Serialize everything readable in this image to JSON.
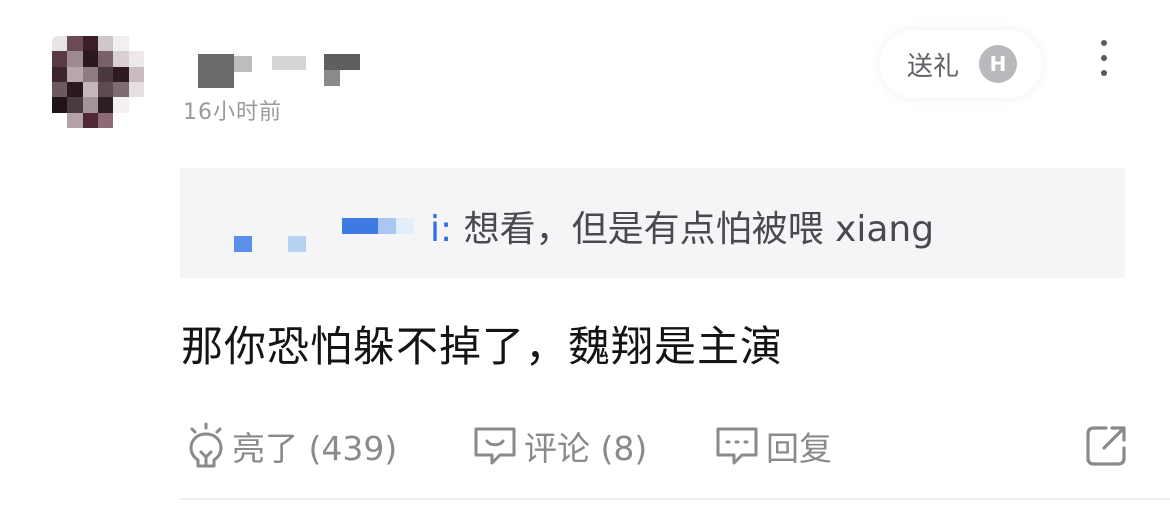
{
  "comment": {
    "timestamp": "16小时前",
    "gift_label": "送礼",
    "gift_coin_letter": "H",
    "quoted": {
      "user_suffix": "i:",
      "text": "想看，但是有点怕被喂 xiang"
    },
    "reply_text": "那你恐怕躲不掉了，魏翔是主演",
    "actions": {
      "like_label": "亮了 (439)",
      "comment_label": "评论 (8)",
      "reply_label": "回复"
    }
  },
  "colors": {
    "link": "#2f6fe0",
    "muted": "#8a8a8e",
    "quote_bg": "#f5f5f7"
  },
  "icons": [
    "lightbulb-icon",
    "comment-icon",
    "reply-icon",
    "share-icon",
    "more-icon",
    "coin-icon"
  ]
}
